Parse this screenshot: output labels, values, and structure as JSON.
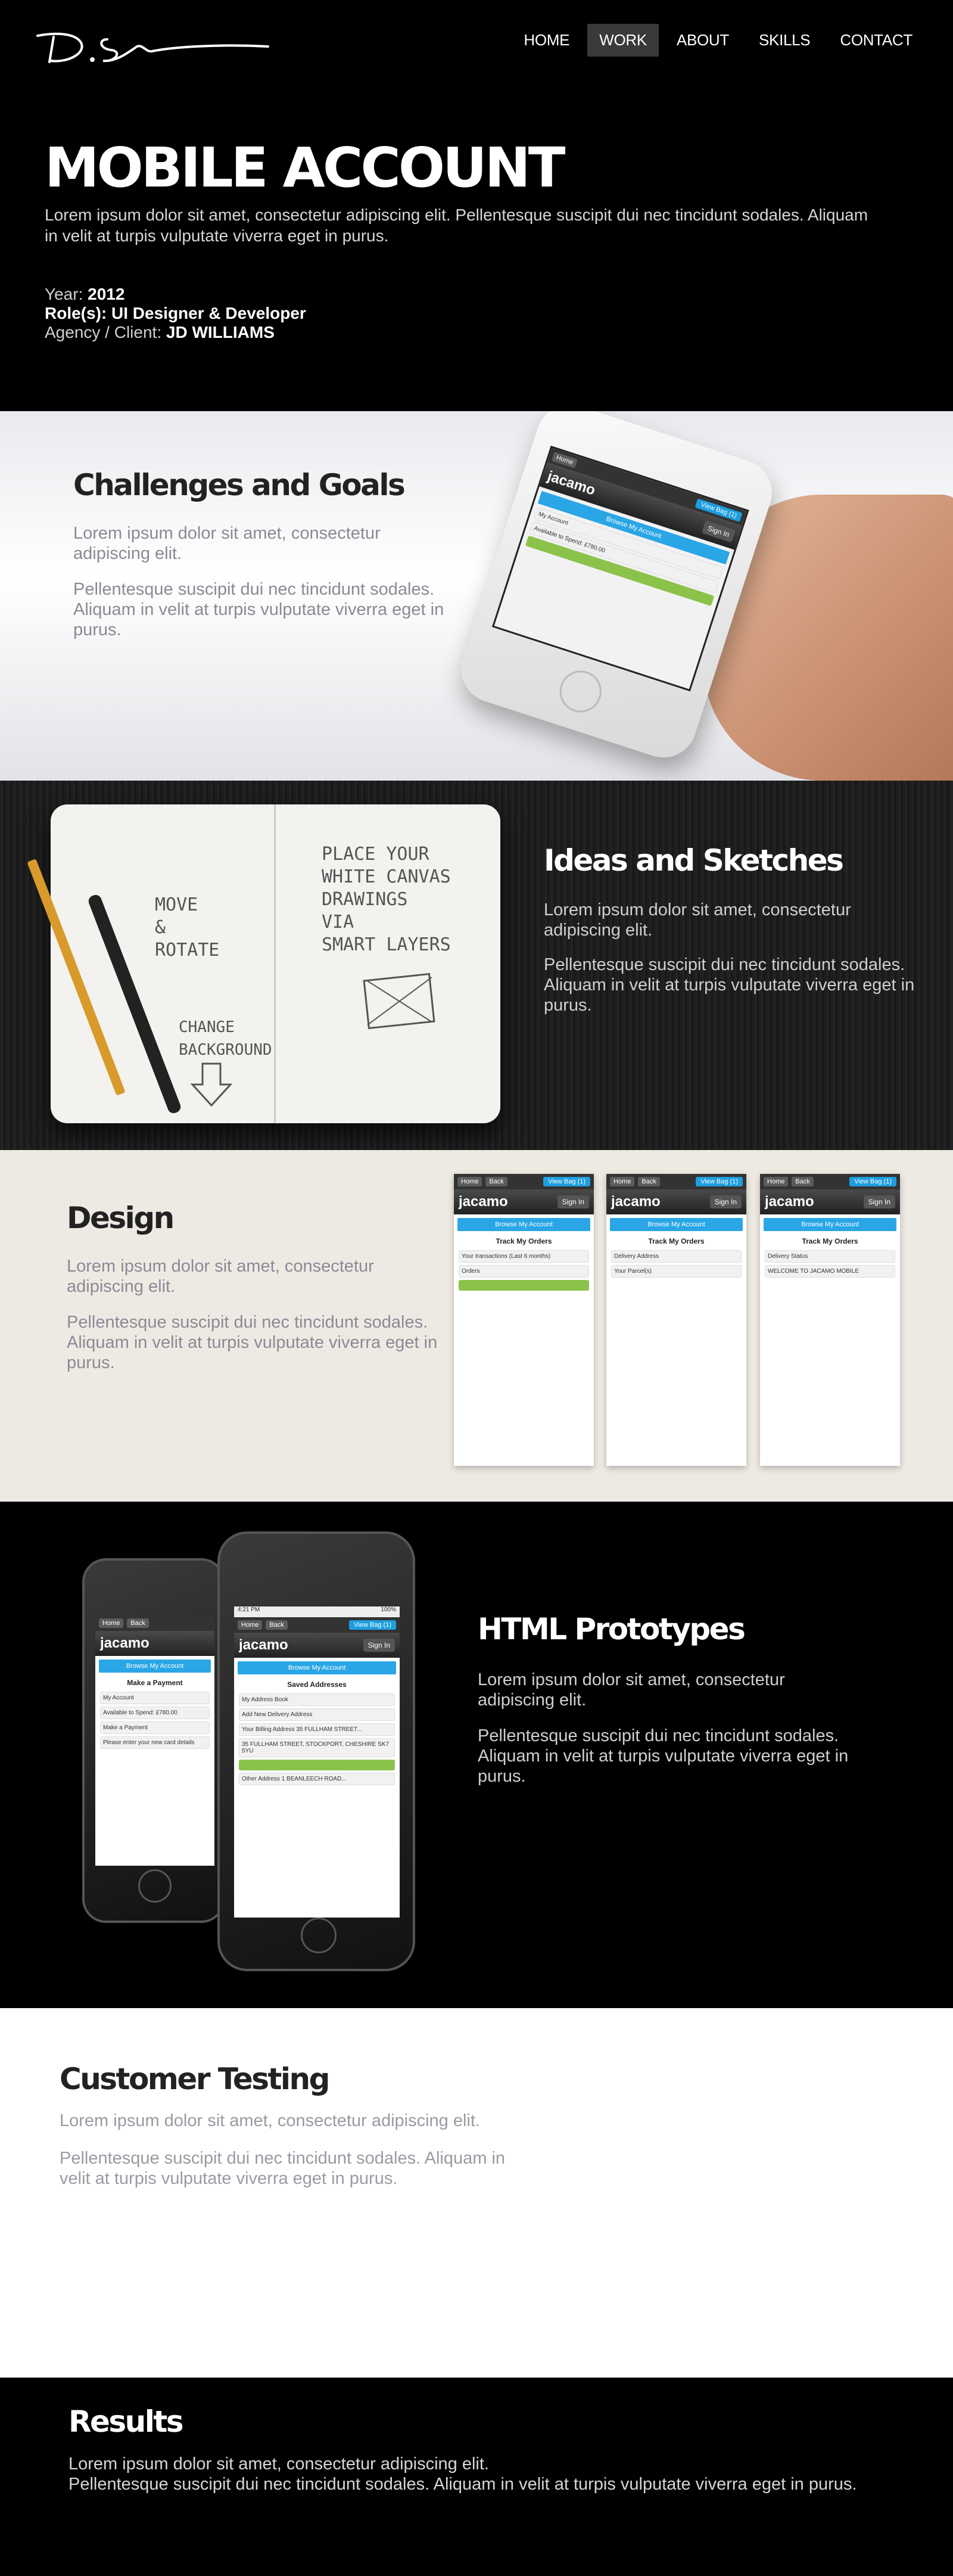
{
  "header": {
    "logo_alt": "D.S signature logo",
    "nav": [
      {
        "label": "HOME",
        "active": false
      },
      {
        "label": "WORK",
        "active": true
      },
      {
        "label": "ABOUT",
        "active": false
      },
      {
        "label": "SKILLS",
        "active": false
      },
      {
        "label": "CONTACT",
        "active": false
      }
    ]
  },
  "hero": {
    "title": "MOBILE ACCOUNT",
    "description": "Lorem ipsum dolor sit amet, consectetur adipiscing elit. Pellentesque suscipit dui nec tincidunt sodales. Aliquam in velit at turpis vulputate viverra eget in purus.",
    "year_label": "Year:",
    "year_value": "2012",
    "roles_label": "Role(s):",
    "roles_value": "UI Designer & Developer",
    "client_label": "Agency / Client:",
    "client_value": "JD WILLIAMS"
  },
  "challenges": {
    "title": "Challenges and Goals",
    "p1": "Lorem ipsum dolor sit amet, consectetur adipiscing elit.",
    "p2": "Pellentesque suscipit dui nec tincidunt sodales. Aliquam in velit at turpis vulputate viverra eget in purus."
  },
  "ideas": {
    "title": "Ideas and Sketches",
    "p1": "Lorem ipsum dolor sit amet, consectetur adipiscing elit.",
    "p2": "Pellentesque suscipit dui nec tincidunt sodales. Aliquam in velit at turpis vulputate viverra eget in purus.",
    "sketch_left": [
      "MOVE",
      "&",
      "ROTATE"
    ],
    "sketch_right": [
      "PLACE YOUR",
      "WHITE CANVAS",
      "DRAWINGS",
      "VIA",
      "SMART LAYERS"
    ],
    "sketch_bottom": [
      "CHANGE",
      "BACKGROUND"
    ]
  },
  "design": {
    "title": "Design",
    "p1": "Lorem ipsum dolor sit amet, consectetur adipiscing elit.",
    "p2": "Pellentesque suscipit dui nec tincidunt sodales. Aliquam in velit at turpis vulputate viverra eget in purus.",
    "screens": [
      {
        "heading": "Track My Orders",
        "row1": "Your transactions (Last 6 months)",
        "row2": "Orders"
      },
      {
        "heading": "Track My Orders",
        "row1": "Delivery Address",
        "row2": "Your Parcel(s)"
      },
      {
        "heading": "Track My Orders",
        "row1": "Delivery Status",
        "row2": "WELCOME TO JACAMO MOBILE"
      }
    ]
  },
  "prototypes": {
    "title": "HTML Prototypes",
    "p1": "Lorem ipsum dolor sit amet, consectetur adipiscing elit.",
    "p2": "Pellentesque suscipit dui nec tincidunt sodales. Aliquam in velit at turpis vulputate viverra eget in purus.",
    "app": {
      "home": "Home",
      "back": "Back",
      "bag": "View Bag (1)",
      "brand": "jacamo",
      "sign_in": "Sign In",
      "browse": "Browse My Account",
      "front_heading": "Saved Addresses",
      "front_rows": [
        "My Address Book",
        "Add New Delivery Address",
        "Your Billing Address 35 FULLHAM STREET...",
        "35 FULLHAM STREET, STOCKPORT, CHESHIRE SK7 5YU",
        "Other Address 1 BEANLEECH ROAD..."
      ],
      "back_heading": "Make a Payment",
      "back_rows": [
        "My Account",
        "Available to Spend: £780.00",
        "Make a Payment",
        "Please enter your new card details"
      ],
      "time": "4:21 PM",
      "battery": "100%"
    }
  },
  "testing": {
    "title": "Customer Testing",
    "p1": "Lorem ipsum dolor sit amet, consectetur adipiscing elit.",
    "p2": "Pellentesque suscipit dui nec tincidunt sodales. Aliquam in velit at turpis vulputate viverra eget in purus."
  },
  "results": {
    "title": "Results",
    "p1": "Lorem ipsum dolor sit amet, consectetur adipiscing elit.",
    "p2": "Pellentesque suscipit dui nec tincidunt sodales. Aliquam in velit at turpis vulputate viverra eget in purus."
  },
  "colors": {
    "accent_blue": "#2aa6e6",
    "nav_active_bg": "#3a3a3a",
    "hero_bg": "#000000",
    "testing_bg": "#ffffff"
  }
}
